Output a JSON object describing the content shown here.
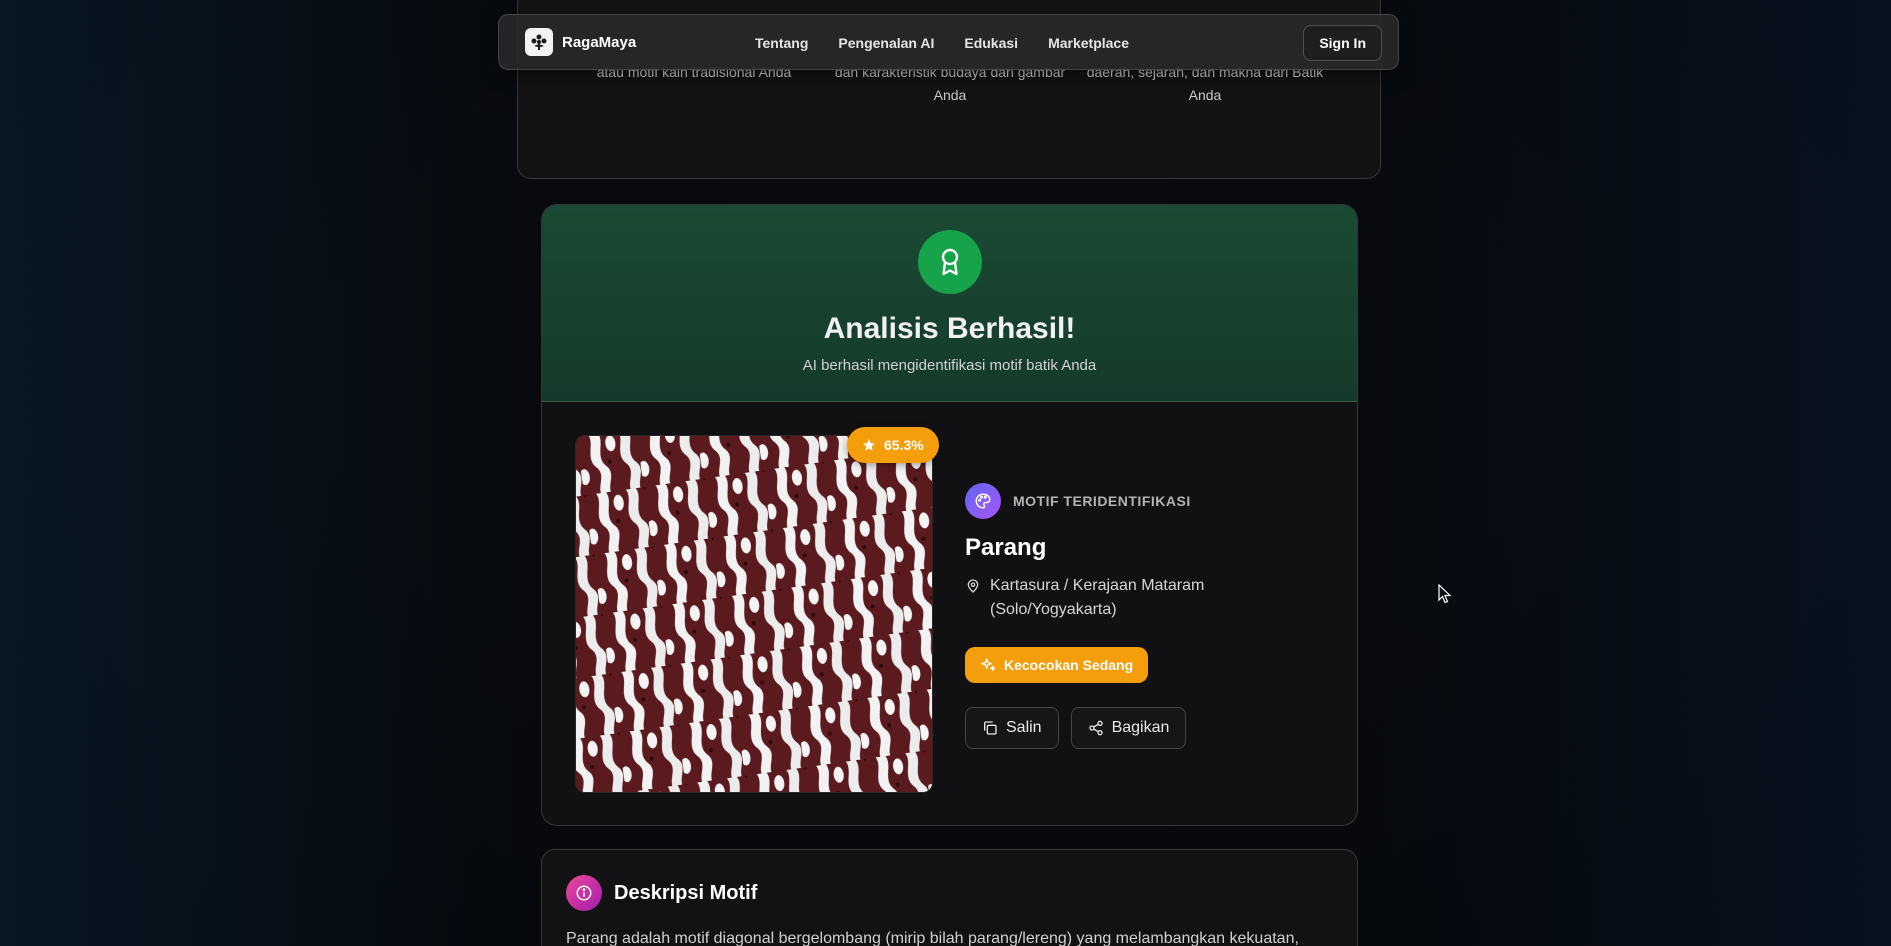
{
  "navbar": {
    "brand": "RagaMaya",
    "links": [
      "Tentang",
      "Pengenalan AI",
      "Edukasi",
      "Marketplace"
    ],
    "signin": "Sign In"
  },
  "steps": {
    "col1": "atau motif kain tradisional Anda",
    "col2": "dan karakteristik budaya dari gambar Anda",
    "col3": "daerah, sejarah, dan makna dari Batik Anda"
  },
  "result": {
    "title": "Analisis Berhasil!",
    "subtitle": "AI berhasil mengidentifikasi motif batik Anda",
    "score": "65.3%",
    "label": "MOTIF TERIDENTIFIKASI",
    "motif_name": "Parang",
    "origin": "Kartasura / Kerajaan Mataram (Solo/Yogyakarta)",
    "match": "Kecocokan Sedang",
    "copy_label": "Salin",
    "share_label": "Bagikan"
  },
  "description": {
    "title": "Deskripsi Motif",
    "text": "Parang adalah motif diagonal bergelombang (mirip bilah parang/lereng) yang melambangkan kekuatan,"
  },
  "colors": {
    "accent_green": "#16a34a",
    "badge_orange": "#f59e0b",
    "batik_maroon": "#5a1a1e"
  }
}
